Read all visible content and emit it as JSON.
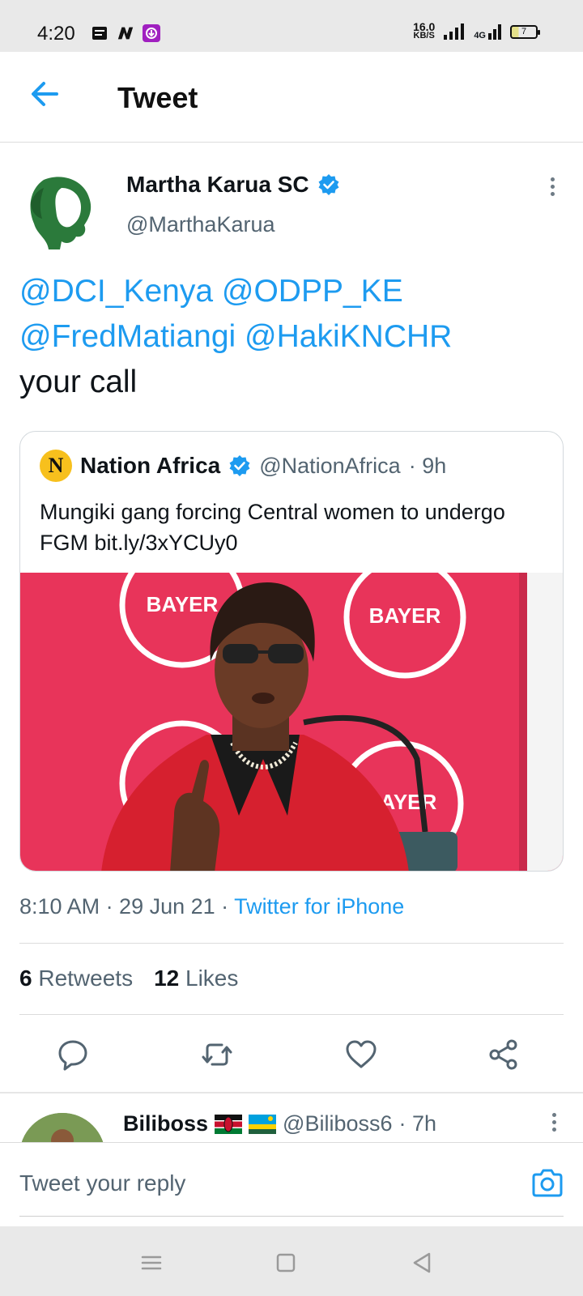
{
  "status_bar": {
    "time": "4:20",
    "icons_left": [
      "notes-icon",
      "n-app-icon",
      "download-app-icon"
    ],
    "net_speed_value": "16.0",
    "net_speed_unit": "KB/S",
    "network": "4G",
    "battery": "7"
  },
  "header": {
    "title": "Tweet"
  },
  "tweet": {
    "author_name": "Martha Karua SC",
    "author_handle": "@MarthaKarua",
    "mentions": [
      "@DCI_Kenya",
      "@ODPP_KE",
      "@FredMatiangi",
      "@HakiKNCHR"
    ],
    "text_tail": "your call",
    "timestamp": "8:10 AM · 29 Jun 21 · ",
    "source": "Twitter for iPhone",
    "retweets_count": "6",
    "retweets_label": "Retweets",
    "likes_count": "12",
    "likes_label": "Likes"
  },
  "quoted": {
    "avatar_letter": "N",
    "name": "Nation Africa",
    "handle": "@NationAfrica",
    "time": "· 9h",
    "text": "Mungiki gang  forcing Central women to undergo FGM bit.ly/3xYCUy0",
    "image_banner": "BAYER"
  },
  "reply": {
    "name": "Biliboss",
    "handle": "@Biliboss6",
    "time": "· 7h"
  },
  "composer": {
    "placeholder": "Tweet your reply"
  },
  "colors": {
    "accent": "#1d9bf0",
    "text": "#0f1419",
    "muted": "#536471"
  }
}
